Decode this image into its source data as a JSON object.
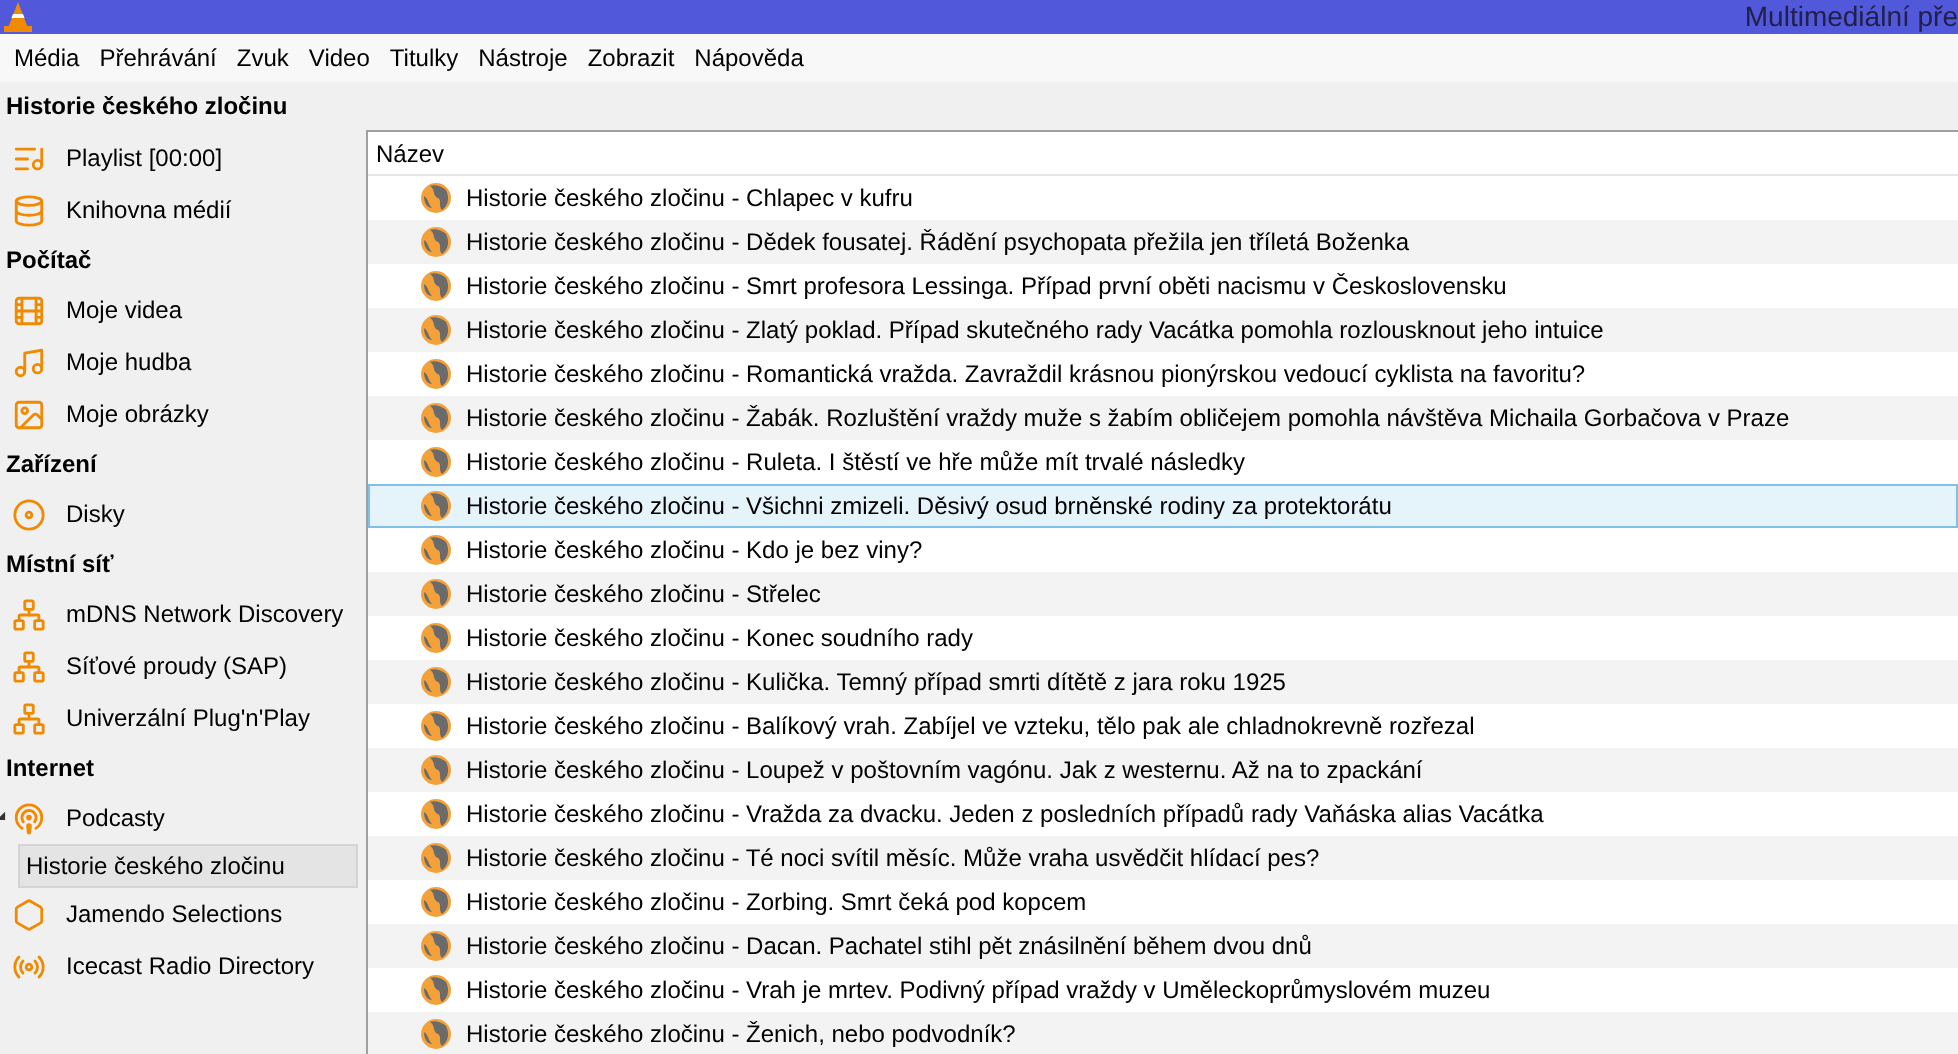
{
  "window": {
    "title": "Multimediální pře"
  },
  "menu": [
    "Média",
    "Přehrávání",
    "Zvuk",
    "Video",
    "Titulky",
    "Nástroje",
    "Zobrazit",
    "Nápověda"
  ],
  "view_title": "Historie českého zločinu",
  "sidebar": {
    "sections": [
      {
        "items": [
          {
            "label": "Playlist [00:00]",
            "selected": false
          },
          {
            "label": "Knihovna médií",
            "selected": false
          }
        ]
      },
      {
        "title": "Počítač",
        "items": [
          {
            "label": "Moje videa",
            "selected": false
          },
          {
            "label": "Moje hudba",
            "selected": false
          },
          {
            "label": "Moje obrázky",
            "selected": false
          }
        ]
      },
      {
        "title": "Zařízení",
        "items": [
          {
            "label": "Disky",
            "selected": false
          }
        ]
      },
      {
        "title": "Místní síť",
        "items": [
          {
            "label": "mDNS Network Discovery",
            "selected": false
          },
          {
            "label": "Síťové proudy (SAP)",
            "selected": false
          },
          {
            "label": "Univerzální Plug'n'Play",
            "selected": false
          }
        ]
      },
      {
        "title": "Internet",
        "items": [
          {
            "label": "Podcasty",
            "selected": false,
            "expanded": true,
            "children": [
              {
                "label": "Historie českého zločinu",
                "selected": true
              }
            ]
          },
          {
            "label": "Jamendo Selections",
            "selected": false
          },
          {
            "label": "Icecast Radio Directory",
            "selected": false
          }
        ]
      }
    ]
  },
  "playlist": {
    "columns": [
      "Název"
    ],
    "rows": [
      {
        "title": "Historie českého zločinu - Chlapec v kufru",
        "selected": false
      },
      {
        "title": "Historie českého zločinu - Dědek fousatej. Řádění psychopata přežila jen tříletá Boženka",
        "selected": false
      },
      {
        "title": "Historie českého zločinu - Smrt profesora Lessinga. Případ první oběti nacismu v Československu",
        "selected": false
      },
      {
        "title": "Historie českého zločinu - Zlatý poklad. Případ skutečného rady Vacátka pomohla rozlousknout jeho intuice",
        "selected": false
      },
      {
        "title": "Historie českého zločinu - Romantická vražda. Zavraždil krásnou pionýrskou vedoucí cyklista na favoritu?",
        "selected": false
      },
      {
        "title": "Historie českého zločinu - Žabák. Rozluštění vraždy muže s žabím obličejem pomohla návštěva Michaila Gorbačova v Praze",
        "selected": false
      },
      {
        "title": "Historie českého zločinu - Ruleta. I štěstí ve hře může mít trvalé následky",
        "selected": false
      },
      {
        "title": "Historie českého zločinu - Všichni zmizeli. Děsivý osud brněnské rodiny za protektorátu",
        "selected": true
      },
      {
        "title": "Historie českého zločinu - Kdo je bez viny?",
        "selected": false
      },
      {
        "title": "Historie českého zločinu - Střelec",
        "selected": false
      },
      {
        "title": "Historie českého zločinu - Konec soudního rady",
        "selected": false
      },
      {
        "title": "Historie českého zločinu - Kulička. Temný případ smrti dítětě z jara roku 1925",
        "selected": false
      },
      {
        "title": "Historie českého zločinu - Balíkový vrah. Zabíjel ve vzteku, tělo pak ale chladnokrevně rozřezal",
        "selected": false
      },
      {
        "title": "Historie českého zločinu - Loupež v poštovním vagónu. Jak z westernu. Až na to zpackání",
        "selected": false
      },
      {
        "title": "Historie českého zločinu - Vražda za dvacku. Jeden z posledních případů rady Vaňáska alias Vacátka",
        "selected": false
      },
      {
        "title": "Historie českého zločinu - Té noci svítil měsíc. Může vraha usvědčit hlídací pes?",
        "selected": false
      },
      {
        "title": "Historie českého zločinu - Zorbing. Smrt čeká pod kopcem",
        "selected": false
      },
      {
        "title": "Historie českého zločinu - Dacan. Pachatel stihl pět znásilnění během dvou dnů",
        "selected": false
      },
      {
        "title": "Historie českého zločinu - Vrah je mrtev. Podivný případ vraždy v Uměleckoprůmyslovém muzeu",
        "selected": false
      },
      {
        "title": "Historie českého zločinu - Ženich, nebo podvodník?",
        "selected": false
      }
    ]
  }
}
